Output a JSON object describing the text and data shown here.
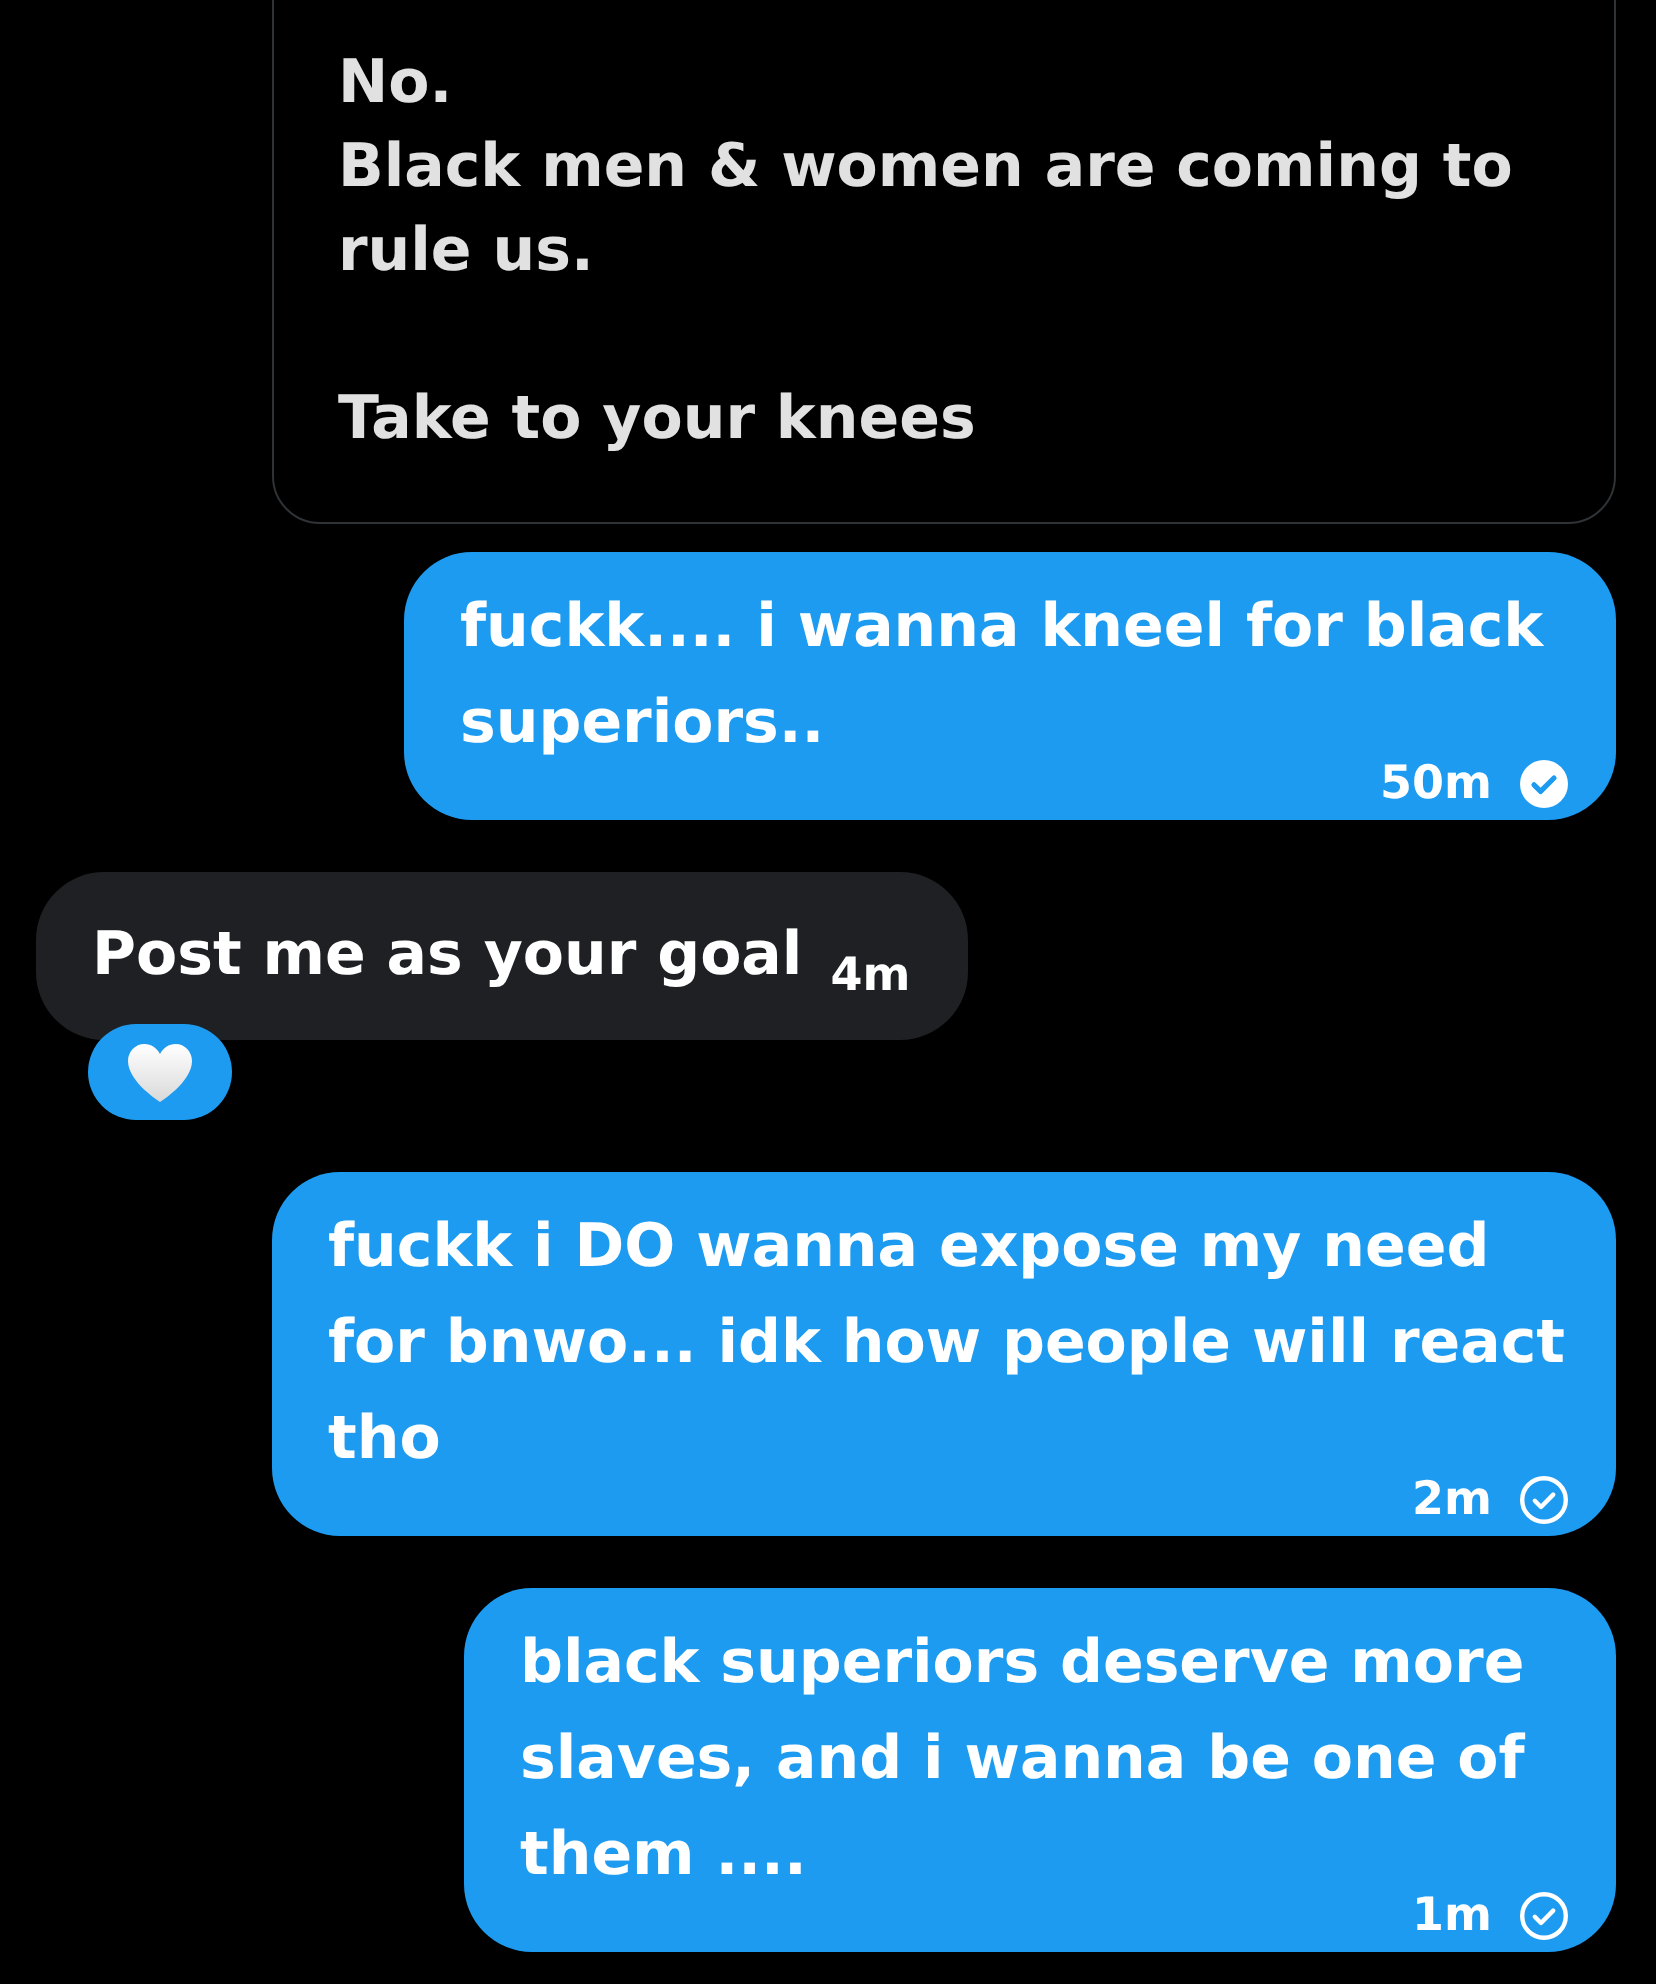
{
  "quoted_post": {
    "text": "No.\nBlack men & women are coming to rule us.\n\nTake to your knees"
  },
  "messages": [
    {
      "kind": "sent",
      "text": "fuckk.... i wanna kneel for black superiors..",
      "time": "50m",
      "seen": true
    },
    {
      "kind": "received",
      "text": "Post me as your goal",
      "time": "4m",
      "reactions": [
        {
          "kind": "heart"
        }
      ]
    },
    {
      "kind": "sent",
      "text": "fuckk i DO wanna expose my need for bnwo... idk how people will react tho",
      "time": "2m",
      "seen": false
    },
    {
      "kind": "sent",
      "text": "black superiors deserve more slaves, and i wanna be one of them ....",
      "time": "1m",
      "seen": false
    }
  ]
}
